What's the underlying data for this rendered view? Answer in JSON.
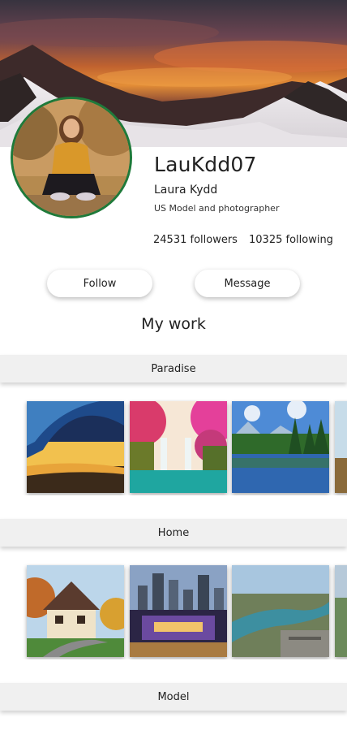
{
  "profile": {
    "username": "LauKdd07",
    "full_name": "Laura Kydd",
    "bio": "US Model and photographer",
    "followers": "24531 followers",
    "following": "10325 following"
  },
  "actions": {
    "follow_label": "Follow",
    "message_label": "Message"
  },
  "sections": {
    "title": "My work",
    "galleries": [
      {
        "name": "Paradise"
      },
      {
        "name": "Home"
      },
      {
        "name": "Model"
      }
    ]
  },
  "colors": {
    "avatar_ring": "#1f7a3a",
    "bar_background": "#f0f0f0"
  }
}
